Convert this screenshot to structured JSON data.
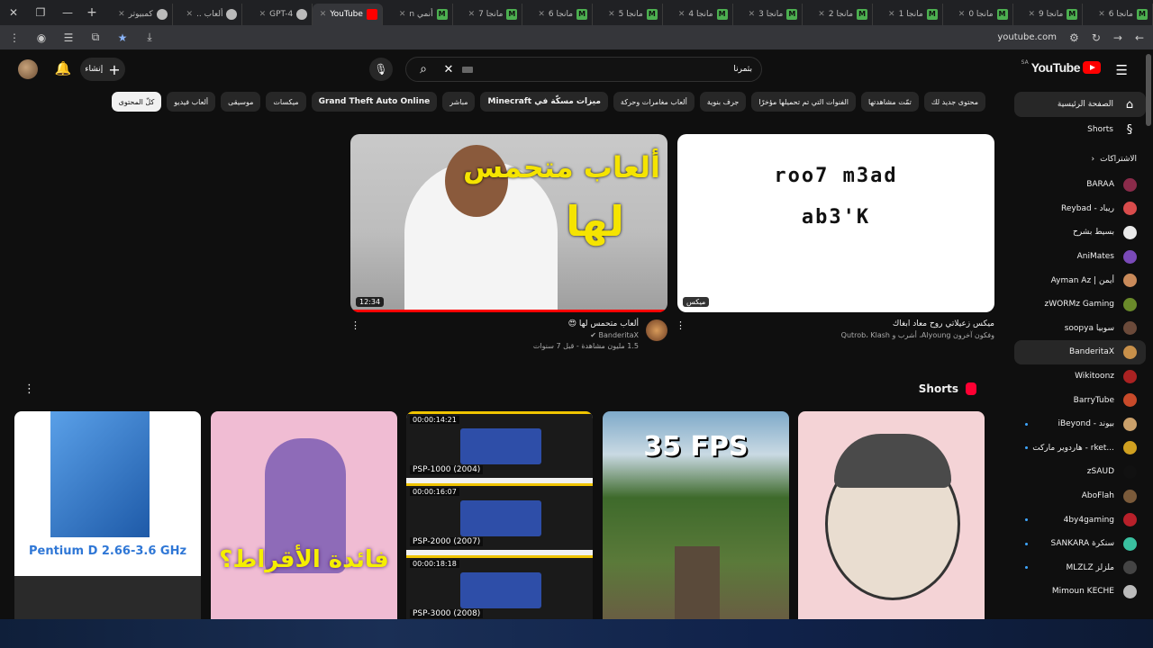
{
  "browser": {
    "tabs": [
      {
        "label": "مانجا 6",
        "icon": "M"
      },
      {
        "label": "مانجا 9",
        "icon": "M"
      },
      {
        "label": "مانجا 0",
        "icon": "M"
      },
      {
        "label": "مانجا 1",
        "icon": "M"
      },
      {
        "label": "مانجا 2",
        "icon": "M"
      },
      {
        "label": "مانجا 3",
        "icon": "M"
      },
      {
        "label": "مانجا 4",
        "icon": "M"
      },
      {
        "label": "مانجا 5",
        "icon": "M"
      },
      {
        "label": "مانجا 6",
        "icon": "M"
      },
      {
        "label": "مانجا 7",
        "icon": "M"
      },
      {
        "label": "أنمي n",
        "icon": "M"
      },
      {
        "label": "YouTube",
        "icon": "yt",
        "active": true
      },
      {
        "label": "GPT-4",
        "icon": "gpt"
      },
      {
        "label": "ألعاب ..",
        "icon": "gpt"
      },
      {
        "label": "كمبيوتر",
        "icon": "gpt"
      }
    ],
    "url": "youtube.com"
  },
  "header": {
    "create_label": "إنشاء",
    "search_value": "بثمرنا",
    "logo_text": "YouTube",
    "region": "SA"
  },
  "chips": [
    {
      "label": "كلّ المحتوى",
      "active": true
    },
    {
      "label": "ألعاب فيديو"
    },
    {
      "label": "موسيقى"
    },
    {
      "label": "ميكسات"
    },
    {
      "label": "Grand Theft Auto Online",
      "bold": true
    },
    {
      "label": "مباشر"
    },
    {
      "label": "ميزات مسكّة في Minecraft",
      "bold": true
    },
    {
      "label": "ألعاب مغامرات وحركة"
    },
    {
      "label": "جرف بنوية"
    },
    {
      "label": "الفنوات التي تم تحميلها مؤخرًا"
    },
    {
      "label": "تمّت مشاهدتها"
    },
    {
      "label": "محتوى جديد لك"
    }
  ],
  "sidebar": {
    "home": "الصفحة الرئيسية",
    "shorts": "Shorts",
    "subscriptions_head": "الاشتراكات",
    "channels": [
      {
        "name": "BARAA",
        "color": "#8a2b4a",
        "dot": false
      },
      {
        "name": "Reybad - ريباد",
        "color": "#d94c4c",
        "dot": false
      },
      {
        "name": "بسيط بشرح",
        "color": "#eaeaea",
        "dot": false
      },
      {
        "name": "AniMates",
        "color": "#7a4ab8",
        "dot": false
      },
      {
        "name": "Ayman Az | أيمن",
        "color": "#c98a5a",
        "dot": false
      },
      {
        "name": "zWORMz Gaming",
        "color": "#6a8a2a",
        "dot": false
      },
      {
        "name": "soopya سوبيا",
        "color": "#6b4a3a",
        "dot": false
      },
      {
        "name": "BanderitaX",
        "color": "#c8904a",
        "dot": false,
        "active": true
      },
      {
        "name": "Wikitoonz",
        "color": "#aa2222",
        "dot": false
      },
      {
        "name": "BarryTube",
        "color": "#c84a2a",
        "dot": false
      },
      {
        "name": "iBeyond - بيوند",
        "color": "#caa06a",
        "dot": true
      },
      {
        "name": "هاردوير ماركت - rket...",
        "color": "#d0a020",
        "dot": true
      },
      {
        "name": "zSAUD",
        "color": "#111111",
        "dot": false
      },
      {
        "name": "AboFlah",
        "color": "#7a5a3a",
        "dot": false
      },
      {
        "name": "4by4gaming",
        "color": "#b8202a",
        "dot": true
      },
      {
        "name": "SANKARA سنكرة",
        "color": "#3ac0a0",
        "dot": true
      },
      {
        "name": "MLZLZ ملزلز",
        "color": "#444444",
        "dot": true
      },
      {
        "name": "Mimoun KECHE",
        "color": "#bbbbbb",
        "dot": false
      }
    ]
  },
  "videos": [
    {
      "title": "ميكس زعيلاتي روح معاد ابغاك",
      "subtitle": "وفكون آخرون Alyoung، أشرب و Qutrob، Klash",
      "thumb_lines": [
        "roo7 m3ad",
        "ab3'K"
      ],
      "badge": "ميكس"
    },
    {
      "title": "ألعاب متحمس لها 😍",
      "channel": "BanderitaX",
      "stats": "1.5 مليون مشاهدة - قبل 7 سنوات",
      "duration": "12:34",
      "thumb_line1": "ألعاب متحمس",
      "thumb_line2": "لها",
      "progress": 1.0
    }
  ],
  "shorts": {
    "title": "Shorts",
    "items": [
      {
        "caption": "Pentium D 2.66-3.6 GHz"
      },
      {
        "caption": "فائدة الأقراط؟"
      },
      {
        "psp": [
          {
            "time": "00:00:14:21",
            "label": "PSP-1000 (2004)"
          },
          {
            "time": "00:00:16:07",
            "label": "PSP-2000 (2007)"
          },
          {
            "time": "00:00:18:18",
            "label": "PSP-3000 (2008)"
          }
        ]
      },
      {
        "caption": "35 FPS"
      },
      {
        "caption": ""
      }
    ]
  }
}
